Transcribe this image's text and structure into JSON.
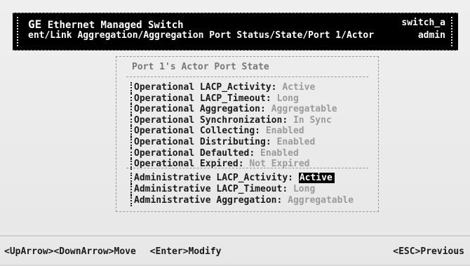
{
  "header": {
    "brand": "GE",
    "title": "Ethernet Managed Switch",
    "breadcrumb": "ent/Link Aggregation/Aggregation Port Status/State/Port 1/Actor",
    "hostname": "switch_a",
    "user": "admin"
  },
  "dialog": {
    "title": "Port 1's Actor Port State",
    "operational": [
      {
        "label": "Operational LACP_Activity: ",
        "value": "Active"
      },
      {
        "label": "Operational LACP_Timeout: ",
        "value": "Long"
      },
      {
        "label": "Operational Aggregation: ",
        "value": "Aggregatable"
      },
      {
        "label": "Operational Synchronization: ",
        "value": "In Sync"
      },
      {
        "label": "Operational Collecting: ",
        "value": "Enabled"
      },
      {
        "label": "Operational Distributing: ",
        "value": "Enabled"
      },
      {
        "label": "Operational Defaulted: ",
        "value": "Enabled"
      },
      {
        "label": "Operational Expired: ",
        "value": "Not Expired"
      }
    ],
    "administrative": [
      {
        "label": "Administrative LACP_Activity: ",
        "value": "Active",
        "selected": true
      },
      {
        "label": "Administrative LACP_Timeout: ",
        "value": "Long"
      },
      {
        "label": "Administrative Aggregation: ",
        "value": "Aggregatable"
      }
    ]
  },
  "footer": {
    "nav_hint": "<UpArrow><DownArrow>Move",
    "modify_hint": "<Enter>Modify",
    "previous_hint": "<ESC>Previous"
  }
}
